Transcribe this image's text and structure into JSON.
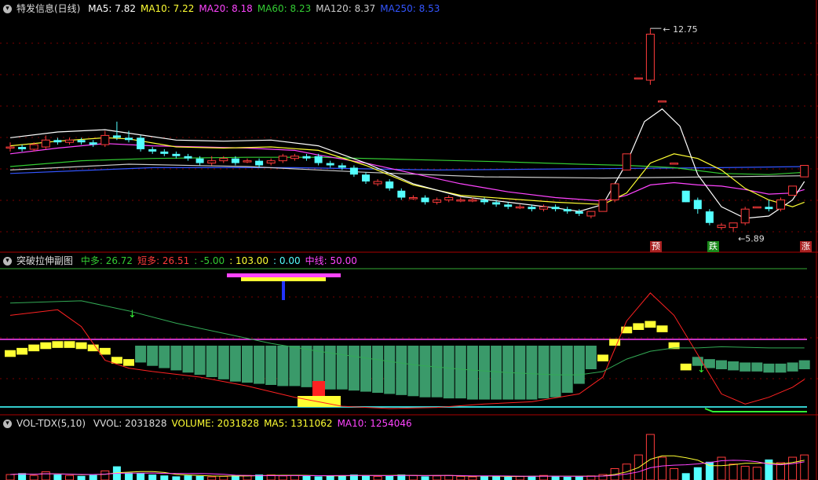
{
  "colors": {
    "up": "#ff3b3b",
    "down": "#54ffff",
    "ma5": "#ffffff",
    "ma10": "#ffff33",
    "ma20": "#ff44ff",
    "ma60": "#33cc33",
    "ma120": "#cccccc",
    "ma250": "#3355ff",
    "grid": "#7a0000",
    "border": "#aa0000",
    "green_bar": "#3a9a6a",
    "yellow": "#ffff33"
  },
  "main": {
    "title": "特发信息(日线)",
    "legend": [
      {
        "name": "MA5",
        "value": "7.82",
        "color": "#ffffff"
      },
      {
        "name": "MA10",
        "value": "7.22",
        "color": "#ffff33"
      },
      {
        "name": "MA20",
        "value": "8.18",
        "color": "#ff44ff"
      },
      {
        "name": "MA60",
        "value": "8.23",
        "color": "#33cc33"
      },
      {
        "name": "MA120",
        "value": "8.37",
        "color": "#cccccc"
      },
      {
        "name": "MA250",
        "value": "8.53",
        "color": "#3355ff"
      }
    ],
    "high_label": "12.75",
    "low_label": "5.89",
    "signals": [
      {
        "text": "预",
        "color": "#aa2222"
      },
      {
        "text": "跌",
        "color": "#1a8a1a"
      },
      {
        "text": "涨",
        "color": "#aa2222"
      }
    ]
  },
  "sub1": {
    "title": "突破拉伸副图",
    "items": [
      {
        "label": "中多:",
        "value": "26.72",
        "color": "#33cc33"
      },
      {
        "label": "短多:",
        "value": "26.51",
        "color": "#ff3b3b"
      },
      {
        "label": ":",
        "value": "-5.00",
        "color": "#33cc33"
      },
      {
        "label": ":",
        "value": "103.00",
        "color": "#ffff33"
      },
      {
        "label": ":",
        "value": "0.00",
        "color": "#54ffff"
      },
      {
        "label": "中线:",
        "value": "50.00",
        "color": "#ff44ff"
      }
    ]
  },
  "sub2": {
    "title": "VOL-TDX(5,10)",
    "items": [
      {
        "label": "VVOL:",
        "value": "2031828",
        "color": "#dddddd"
      },
      {
        "label": "VOLUME:",
        "value": "2031828",
        "color": "#ffff33"
      },
      {
        "label": "MA5:",
        "value": "1311062",
        "color": "#ffff33"
      },
      {
        "label": "MA10:",
        "value": "1254046",
        "color": "#ff44ff"
      }
    ]
  },
  "chart_data": {
    "type": "candlestick",
    "price_high": 12.75,
    "price_low": 5.89,
    "candles": [
      [
        7.6,
        7.6,
        7.8,
        7.4
      ],
      [
        7.6,
        7.5,
        7.7,
        7.4
      ],
      [
        7.5,
        7.7,
        7.8,
        7.4
      ],
      [
        7.6,
        7.9,
        8.1,
        7.5
      ],
      [
        7.9,
        7.8,
        8.0,
        7.7
      ],
      [
        7.8,
        7.9,
        8.0,
        7.7
      ],
      [
        7.9,
        7.8,
        8.0,
        7.7
      ],
      [
        7.8,
        7.7,
        7.9,
        7.6
      ],
      [
        7.7,
        8.1,
        8.3,
        7.6
      ],
      [
        8.1,
        8.0,
        8.7,
        7.9
      ],
      [
        8.0,
        7.9,
        8.3,
        7.8
      ],
      [
        8.0,
        7.5,
        8.1,
        7.4
      ],
      [
        7.5,
        7.4,
        7.6,
        7.3
      ],
      [
        7.4,
        7.3,
        7.5,
        7.2
      ],
      [
        7.3,
        7.2,
        7.4,
        7.1
      ],
      [
        7.2,
        7.1,
        7.3,
        7.0
      ],
      [
        7.1,
        6.9,
        7.2,
        6.8
      ],
      [
        6.9,
        7.0,
        7.2,
        6.8
      ],
      [
        7.0,
        7.1,
        7.2,
        6.9
      ],
      [
        7.1,
        6.9,
        7.2,
        6.8
      ],
      [
        7.0,
        7.0,
        7.1,
        6.9
      ],
      [
        7.0,
        6.8,
        7.1,
        6.7
      ],
      [
        6.9,
        7.0,
        7.1,
        6.8
      ],
      [
        7.0,
        7.2,
        7.3,
        6.9
      ],
      [
        7.1,
        7.2,
        7.3,
        7.0
      ],
      [
        7.2,
        7.1,
        7.3,
        7.0
      ],
      [
        7.2,
        6.9,
        7.3,
        6.8
      ],
      [
        6.9,
        6.8,
        7.0,
        6.7
      ],
      [
        6.8,
        6.7,
        6.9,
        6.6
      ],
      [
        6.7,
        6.4,
        6.8,
        6.3
      ],
      [
        6.4,
        6.1,
        6.5,
        6.0
      ],
      [
        6.0,
        6.1,
        6.2,
        5.9
      ],
      [
        6.1,
        5.8,
        6.2,
        5.7
      ],
      [
        5.7,
        5.4,
        5.8,
        5.3
      ],
      [
        5.4,
        5.4,
        5.5,
        5.3
      ],
      [
        5.4,
        5.2,
        5.5,
        5.1
      ],
      [
        5.2,
        5.3,
        5.4,
        5.1
      ],
      [
        5.3,
        5.4,
        5.5,
        5.2
      ],
      [
        5.3,
        5.3,
        5.4,
        5.2
      ],
      [
        5.3,
        5.3,
        5.4,
        5.2
      ],
      [
        5.3,
        5.2,
        5.4,
        5.1
      ],
      [
        5.2,
        5.1,
        5.3,
        5.0
      ],
      [
        5.1,
        5.0,
        5.2,
        4.9
      ],
      [
        5.0,
        5.0,
        5.1,
        4.9
      ],
      [
        5.0,
        4.9,
        5.1,
        4.8
      ],
      [
        4.9,
        5.0,
        5.1,
        4.8
      ],
      [
        5.0,
        4.9,
        5.1,
        4.8
      ],
      [
        4.9,
        4.8,
        5.0,
        4.7
      ],
      [
        4.8,
        4.7,
        4.9,
        4.6
      ],
      [
        4.6,
        4.8,
        4.8,
        4.5
      ],
      [
        4.8,
        5.3,
        5.3,
        4.8
      ],
      [
        5.3,
        6.0,
        6.0,
        5.2
      ],
      [
        6.6,
        7.3,
        7.3,
        6.6
      ],
      [
        10.6,
        10.6,
        10.6,
        10.6
      ],
      [
        10.5,
        12.5,
        12.75,
        10.3
      ],
      [
        9.6,
        9.6,
        9.6,
        9.6
      ],
      [
        6.9,
        6.9,
        6.9,
        6.9
      ],
      [
        5.7,
        5.2,
        5.7,
        5.2
      ],
      [
        5.3,
        4.9,
        5.4,
        4.7
      ],
      [
        4.8,
        4.3,
        4.9,
        4.2
      ],
      [
        4.1,
        4.2,
        4.3,
        4.0
      ],
      [
        4.1,
        4.3,
        4.3,
        3.9
      ],
      [
        4.3,
        4.9,
        5.0,
        4.2
      ],
      [
        5.0,
        5.0,
        5.0,
        5.0
      ],
      [
        5.0,
        4.9,
        5.3,
        4.8
      ],
      [
        4.9,
        5.3,
        5.4,
        4.8
      ],
      [
        5.5,
        5.9,
        5.9,
        5.5
      ],
      [
        6.3,
        6.8,
        6.8,
        6.3
      ]
    ],
    "vol_ma5": [
      [
        0,
        8.0
      ],
      [
        4,
        8.25
      ],
      [
        8,
        8.35
      ],
      [
        10,
        8.2
      ],
      [
        14,
        7.9
      ],
      [
        18,
        7.85
      ],
      [
        22,
        7.9
      ],
      [
        26,
        7.65
      ],
      [
        30,
        6.9
      ],
      [
        34,
        6.0
      ],
      [
        38,
        5.45
      ],
      [
        42,
        5.2
      ],
      [
        46,
        4.95
      ],
      [
        48,
        4.8
      ],
      [
        50,
        5.1
      ],
      [
        52,
        6.9
      ],
      [
        53.5,
        8.7
      ],
      [
        55,
        9.25
      ],
      [
        56.5,
        8.5
      ],
      [
        58,
        6.4
      ],
      [
        60,
        5.0
      ],
      [
        62,
        4.5
      ],
      [
        64,
        4.6
      ],
      [
        66,
        5.3
      ],
      [
        67,
        6.1
      ]
    ],
    "ma10": [
      [
        0,
        7.65
      ],
      [
        4,
        7.85
      ],
      [
        8,
        8.0
      ],
      [
        10,
        7.95
      ],
      [
        14,
        7.6
      ],
      [
        18,
        7.55
      ],
      [
        22,
        7.6
      ],
      [
        26,
        7.45
      ],
      [
        30,
        6.8
      ],
      [
        34,
        5.95
      ],
      [
        38,
        5.5
      ],
      [
        42,
        5.35
      ],
      [
        46,
        5.2
      ],
      [
        50,
        5.1
      ],
      [
        52,
        5.6
      ],
      [
        54,
        6.9
      ],
      [
        56,
        7.3
      ],
      [
        58,
        7.1
      ],
      [
        60,
        6.6
      ],
      [
        62,
        5.8
      ],
      [
        64,
        5.3
      ],
      [
        66,
        5.0
      ],
      [
        67,
        5.2
      ]
    ],
    "ma20": [
      [
        0,
        7.3
      ],
      [
        4,
        7.55
      ],
      [
        8,
        7.75
      ],
      [
        12,
        7.65
      ],
      [
        16,
        7.6
      ],
      [
        20,
        7.55
      ],
      [
        24,
        7.45
      ],
      [
        26,
        7.25
      ],
      [
        30,
        6.9
      ],
      [
        34,
        6.45
      ],
      [
        38,
        6.0
      ],
      [
        42,
        5.65
      ],
      [
        46,
        5.4
      ],
      [
        50,
        5.25
      ],
      [
        52,
        5.5
      ],
      [
        54,
        5.95
      ],
      [
        56,
        6.05
      ],
      [
        58,
        5.95
      ],
      [
        60,
        5.9
      ],
      [
        62,
        5.75
      ],
      [
        64,
        5.55
      ],
      [
        66,
        5.6
      ],
      [
        67,
        5.75
      ]
    ],
    "ma60": [
      [
        0,
        6.75
      ],
      [
        6,
        7.0
      ],
      [
        12,
        7.1
      ],
      [
        20,
        7.15
      ],
      [
        26,
        7.15
      ],
      [
        34,
        7.05
      ],
      [
        42,
        6.95
      ],
      [
        48,
        6.85
      ],
      [
        52,
        6.8
      ],
      [
        56,
        6.7
      ],
      [
        60,
        6.45
      ],
      [
        64,
        6.4
      ],
      [
        67,
        6.5
      ]
    ],
    "ma120": [
      [
        0,
        6.6
      ],
      [
        10,
        6.85
      ],
      [
        20,
        6.75
      ],
      [
        30,
        6.5
      ],
      [
        40,
        6.3
      ],
      [
        50,
        6.25
      ],
      [
        60,
        6.3
      ],
      [
        67,
        6.35
      ]
    ],
    "ma250": [
      [
        0,
        6.45
      ],
      [
        12,
        6.7
      ],
      [
        24,
        6.7
      ],
      [
        36,
        6.6
      ],
      [
        48,
        6.65
      ],
      [
        60,
        6.7
      ],
      [
        67,
        6.75
      ]
    ],
    "indicator": {
      "bars_top": [
        66,
        64,
        61,
        59,
        58,
        58,
        59,
        61,
        64,
        72,
        74,
        77,
        80,
        82,
        84,
        86,
        88,
        90,
        92,
        94,
        95,
        96,
        97,
        98,
        98,
        99,
        100,
        101,
        101,
        102,
        103,
        104,
        105,
        106,
        107,
        108,
        108,
        109,
        109,
        110,
        110,
        110,
        110,
        110,
        110,
        109,
        108,
        104,
        96,
        83,
        70,
        56,
        45,
        42,
        40,
        44,
        59,
        78,
        80,
        82,
        83,
        84,
        85,
        85,
        86,
        86,
        85,
        83
      ],
      "base": 100,
      "bottom": 0,
      "short_line": [
        [
          0,
          35
        ],
        [
          4,
          30
        ],
        [
          6,
          45
        ],
        [
          8,
          75
        ],
        [
          10,
          82
        ],
        [
          12,
          85
        ],
        [
          16,
          90
        ],
        [
          20,
          98
        ],
        [
          24,
          108
        ],
        [
          26,
          112
        ],
        [
          28,
          116
        ],
        [
          32,
          118
        ],
        [
          36,
          117
        ],
        [
          40,
          114
        ],
        [
          44,
          112
        ],
        [
          48,
          105
        ],
        [
          50,
          90
        ],
        [
          52,
          40
        ],
        [
          54,
          15
        ],
        [
          56,
          35
        ],
        [
          58,
          70
        ],
        [
          60,
          105
        ],
        [
          62,
          114
        ],
        [
          64,
          108
        ],
        [
          66,
          99
        ],
        [
          67,
          92
        ]
      ],
      "mid_line": [
        [
          0,
          24
        ],
        [
          6,
          22
        ],
        [
          10,
          31
        ],
        [
          14,
          42
        ],
        [
          18,
          51
        ],
        [
          22,
          60
        ],
        [
          26,
          67
        ],
        [
          30,
          73
        ],
        [
          34,
          79
        ],
        [
          38,
          83
        ],
        [
          42,
          86
        ],
        [
          46,
          88
        ],
        [
          48,
          88
        ],
        [
          50,
          85
        ],
        [
          52,
          74
        ],
        [
          54,
          67
        ],
        [
          56,
          64
        ],
        [
          58,
          64
        ],
        [
          60,
          63
        ],
        [
          64,
          64
        ],
        [
          67,
          64
        ]
      ]
    }
  }
}
